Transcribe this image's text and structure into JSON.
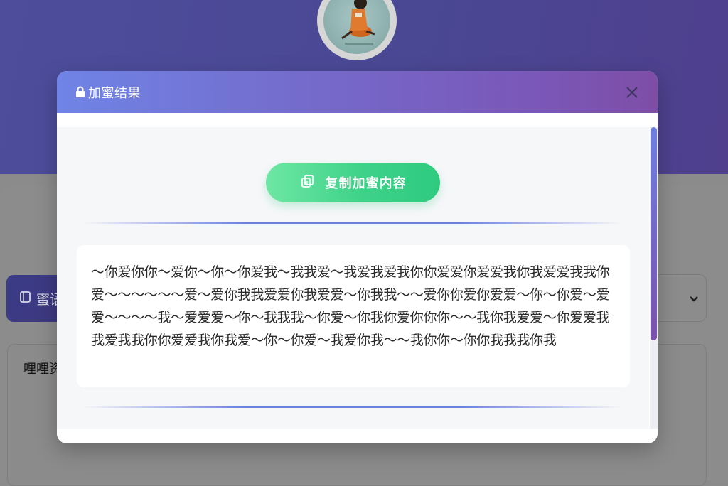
{
  "background": {
    "tab_label": "蜜语",
    "textarea_placeholder": "哩哩资"
  },
  "modal": {
    "title": "加蜜结果",
    "copy_button_label": "复制加蜜内容",
    "result_text": "～你爱你你～爱你～你～你爱我～我我爱～我爱我爱我你你爱爱你爱爱我你我爱爱我我你爱～～～～～～爱～爱你我我爱爱你我爱爱～你我我～～爱你你爱你爱爱～你～你爱～爱爱～～～～我～爱爱爱～你～我我我～你爱～你我你爱你你你～～我你我爱爱～你爱爱我我爱我我你你爱爱我你我爱～你～你爱～我爱你我～～我你你～你你我我我你我"
  },
  "colors": {
    "header_start": "#6f84e6",
    "header_end": "#7e4ea6",
    "button_start": "#6ee7a4",
    "button_end": "#2ecb7f"
  },
  "icons": {
    "lock": "lock-icon",
    "close": "close-icon",
    "copy": "copy-icon",
    "chevron": "chevron-down-icon",
    "book": "book-icon"
  }
}
